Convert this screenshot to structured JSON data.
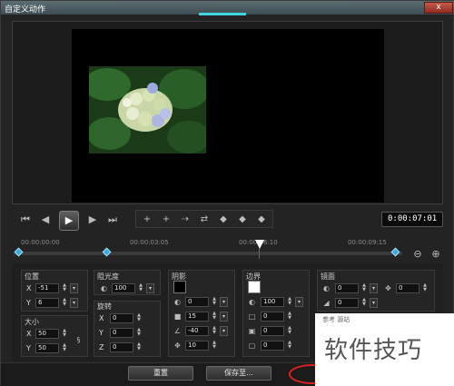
{
  "window": {
    "title": "自定义动作",
    "close": "x"
  },
  "playback": {
    "home": "⏮",
    "prev": "◀",
    "play": "▶",
    "next": "▶",
    "end": "⏭",
    "timecode": "0:00:07:01",
    "spin": "▴\n▾"
  },
  "tools": [
    "+",
    "+",
    "⇢",
    "⇄",
    "◆",
    "◆",
    "◆"
  ],
  "ruler": {
    "t0": "00:00:00:00",
    "t1": "00:00:03:05",
    "t2": "00:00:06:10",
    "t3": "00:00:09:15"
  },
  "labels": {
    "position": "位置",
    "size": "大小",
    "opacity": "阻光度",
    "rotation": "旋转",
    "shadow": "阴影",
    "border": "边界",
    "mirror": "镜面"
  },
  "values": {
    "pos_x": "-51",
    "pos_y": "6",
    "size_x": "50",
    "size_y": "50",
    "opacity": "100",
    "rot_x": "0",
    "rot_y": "0",
    "rot_z": "0",
    "shadow_opacity": "0",
    "shadow_blur": "15",
    "shadow_dir": "-40",
    "shadow_dist": "10",
    "border_opacity": "100",
    "border_w1": "0",
    "border_w2": "0",
    "border_w3": "0",
    "mirror_opacity": "0",
    "mirror_offset": "0",
    "mirror_dist": "0"
  },
  "axis": {
    "x": "X",
    "y": "Y",
    "z": "Z"
  },
  "colors": {
    "shadow": "#000000",
    "border": "#ffffff"
  },
  "buttons": {
    "reset": "重置",
    "save": "保存至..."
  },
  "watermark": {
    "text": "软件技巧",
    "small": "参考 源站"
  }
}
